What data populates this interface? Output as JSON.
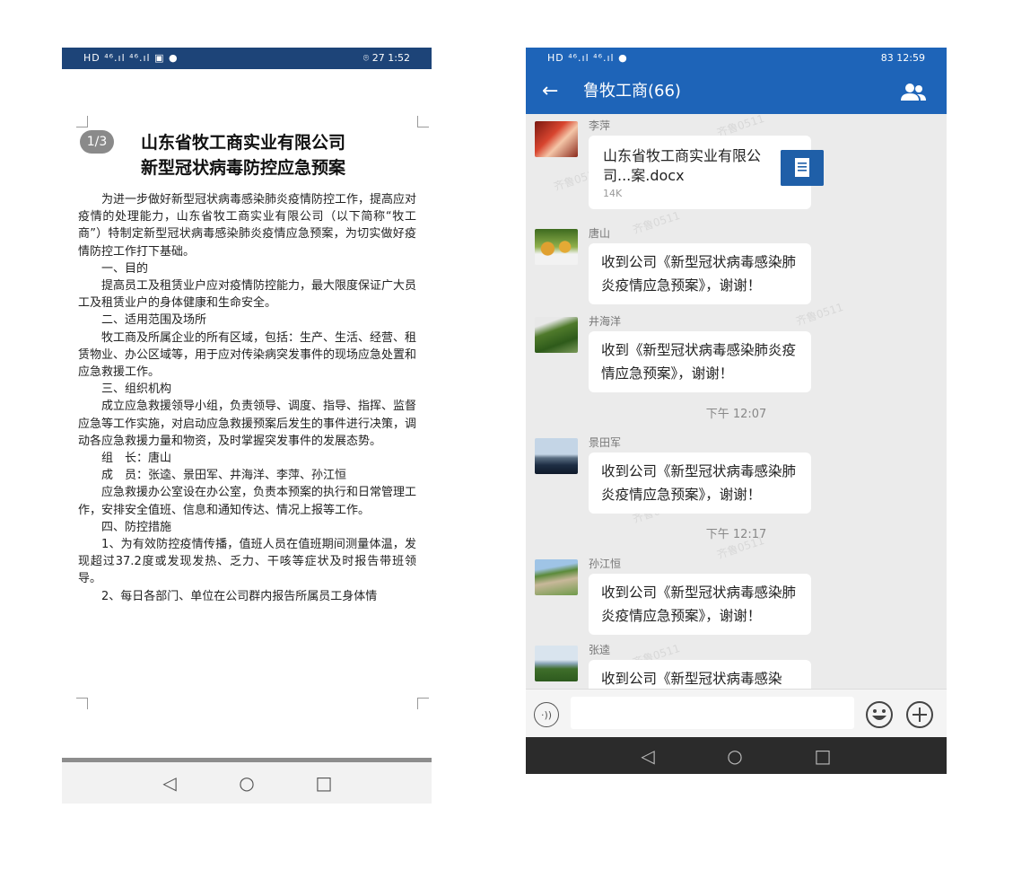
{
  "left": {
    "status": {
      "left": "HD ⁴⁶.ıl ⁴⁶.ıl ▣ ●",
      "right": "⌾ 27 1:52"
    },
    "page_badge": "1/3",
    "title_line1": "山东省牧工商实业有限公司",
    "title_line2": "新型冠状病毒防控应急预案",
    "paragraphs": [
      "为进一步做好新型冠状病毒感染肺炎疫情防控工作，提高应对疫情的处理能力，山东省牧工商实业有限公司（以下简称“牧工商”）特制定新型冠状病毒感染肺炎疫情应急预案，为切实做好疫情防控工作打下基础。",
      "一、目的",
      "提高员工及租赁业户应对疫情防控能力，最大限度保证广大员工及租赁业户的身体健康和生命安全。",
      "二、适用范围及场所",
      "牧工商及所属企业的所有区域，包括：生产、生活、经营、租赁物业、办公区域等，用于应对传染病突发事件的现场应急处置和应急救援工作。",
      "三、组织机构",
      "成立应急救援领导小组，负责领导、调度、指导、指挥、监督应急等工作实施，对启动应急救援预案后发生的事件进行决策，调动各应急救援力量和物资，及时掌握突发事件的发展态势。",
      "组　长：唐山",
      "成　员：张逵、景田军、井海洋、李萍、孙江恒",
      "应急救援办公室设在办公室，负责本预案的执行和日常管理工作，安排安全值班、信息和通知传达、情况上报等工作。",
      "四、防控措施",
      "1、为有效防控疫情传播，值班人员在值班期间测量体温，发现超过37.2度或发现发热、乏力、干咳等症状及时报告带班领导。",
      "2、每日各部门、单位在公司群内报告所属员工身体情"
    ],
    "nav": {
      "back": "◁",
      "home": "○",
      "recent": "□"
    }
  },
  "right": {
    "status": {
      "left": "HD ⁴⁶.ıl ⁴⁶.ıl ●",
      "right": "83 12:59"
    },
    "back_icon": "←",
    "chat_title": "鲁牧工商(66)",
    "messages": [
      {
        "sender": "李萍",
        "type": "file",
        "file_name": "山东省牧工商实业有限公司...案.docx",
        "file_size": "14K"
      },
      {
        "sender": "唐山",
        "type": "text",
        "text": "收到公司《新型冠状病毒感染肺炎疫情应急预案》，谢谢！"
      },
      {
        "sender": "井海洋",
        "type": "text",
        "text": "收到《新型冠状病毒感染肺炎疫情应急预案》，谢谢！"
      },
      {
        "sender": "景田军",
        "type": "text",
        "text": "收到公司《新型冠状病毒感染肺炎疫情应急预案》，谢谢！"
      },
      {
        "sender": "孙江恒",
        "type": "text",
        "text": "收到公司《新型冠状病毒感染肺炎疫情应急预案》，谢谢！"
      },
      {
        "sender": "张逵",
        "type": "text",
        "text": "收到公司《新型冠状病毒感染"
      }
    ],
    "time_separators": [
      "下午 12:07",
      "下午 12:17"
    ],
    "watermark": "齐鲁0511",
    "nav": {
      "back": "◁",
      "home": "○",
      "recent": "□"
    }
  }
}
